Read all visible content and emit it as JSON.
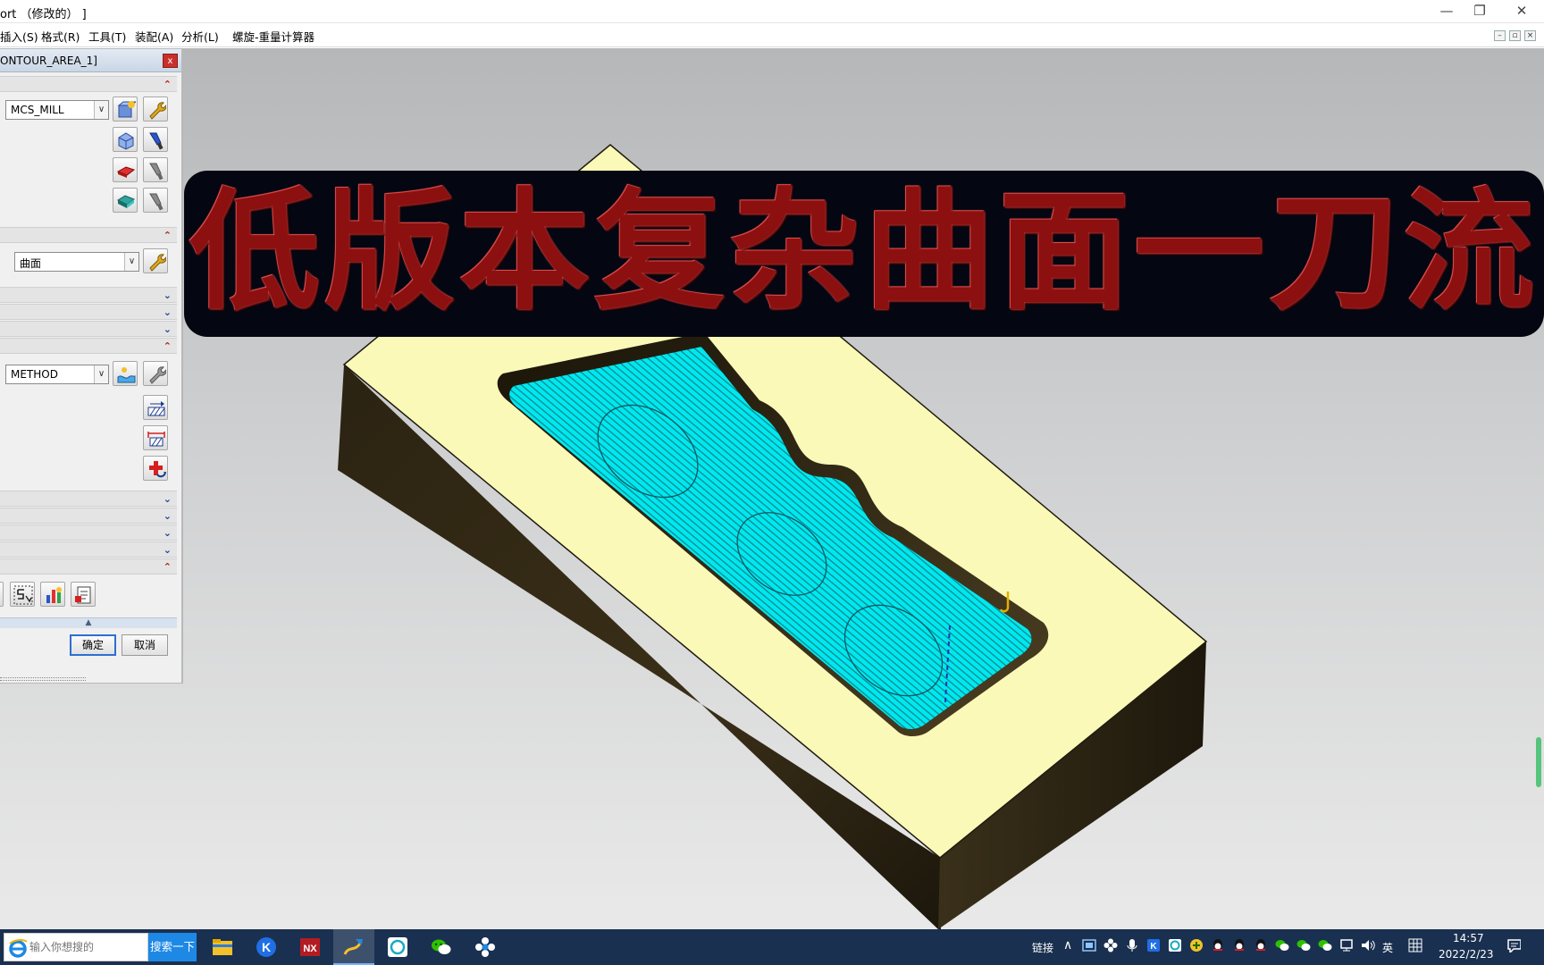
{
  "window": {
    "title": "ort （修改的） ]",
    "controls": {
      "minimize": "—",
      "restore": "❐",
      "close": "✕"
    }
  },
  "menubar": {
    "items": [
      "插入(S)",
      "格式(R)",
      "工具(T)",
      "装配(A)",
      "分析(L)",
      "螺旋-重量计算器"
    ],
    "mdi": {
      "minimize": "–",
      "restore": "▫",
      "close": "×"
    }
  },
  "dialog": {
    "title": "ONTOUR_AREA_1]",
    "geometry_combo": "MCS_MILL",
    "drive_method_combo": "曲面",
    "method_combo": "METHOD",
    "ok_label": "确定",
    "cancel_label": "取消"
  },
  "banner": {
    "text": "低版本复杂曲面一刀流"
  },
  "taskbar": {
    "search_placeholder": "输入你想搜的",
    "search_button": "搜索一下",
    "link_label": "链接",
    "ime_label": "英",
    "time": "14:57",
    "date": "2022/2/23",
    "apps": [
      "file-explorer",
      "kugou-music",
      "nx",
      "sketch-app",
      "ring-app",
      "wechat",
      "settings-flower"
    ]
  },
  "colors": {
    "part_top": "#fbf9b8",
    "part_side": "#2c2312",
    "toolpath": "#00f0f0",
    "banner_bg": "#040611",
    "banner_text": "#8d1010",
    "taskbar": "#1a3050"
  }
}
